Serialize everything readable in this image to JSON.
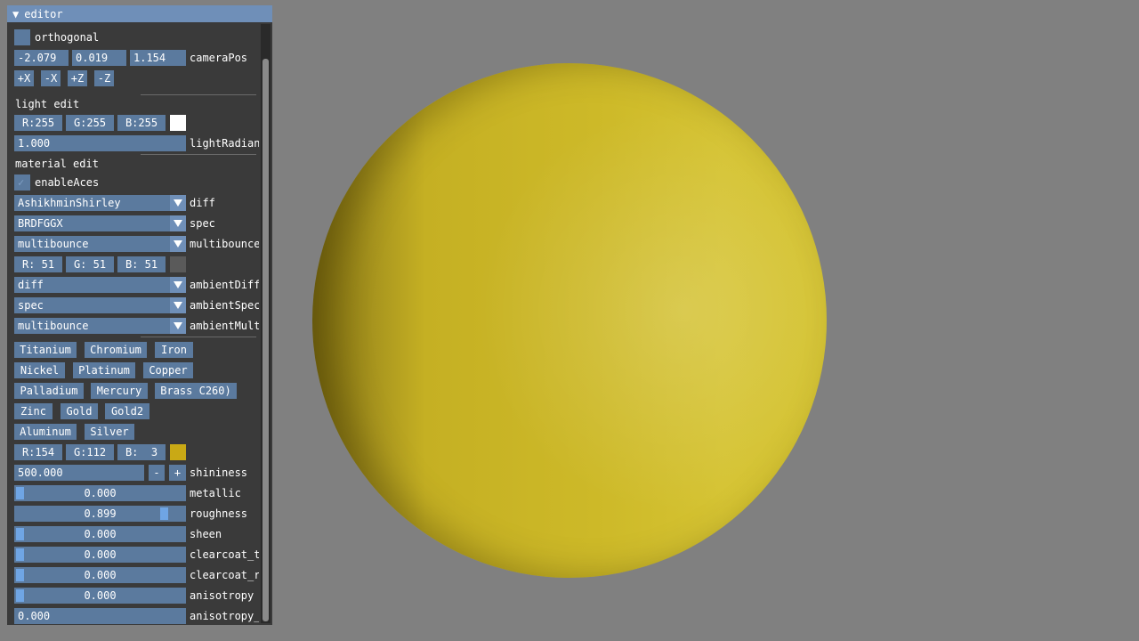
{
  "window": {
    "title": "editor",
    "collapse_glyph": "▼"
  },
  "camera": {
    "orthogonal_label": "orthogonal",
    "pos": [
      "-2.079",
      "0.019",
      "1.154"
    ],
    "pos_label": "cameraPos",
    "buttons": [
      "+X",
      "-X",
      "+Z",
      "-Z"
    ]
  },
  "light": {
    "header": "light edit",
    "rgb": [
      "R:255",
      "G:255",
      "B:255"
    ],
    "swatch_color": "#ffffff",
    "radiance": "1.000",
    "radiance_label": "lightRadian"
  },
  "material": {
    "header": "material edit",
    "enable_aces_label": "enableAces",
    "enable_aces_checked": true,
    "diff": {
      "value": "AshikhminShirley",
      "label": "diff"
    },
    "spec": {
      "value": "BRDFGGX",
      "label": "spec"
    },
    "multibounce": {
      "value": "multibounce",
      "label": "multibounce"
    },
    "ambient_rgb": [
      "R: 51",
      "G: 51",
      "B: 51"
    ],
    "ambient_swatch_color": "#333333",
    "ambient_diff": {
      "value": "diff",
      "label": "ambientDiff"
    },
    "ambient_spec": {
      "value": "spec",
      "label": "ambientSpec"
    },
    "ambient_mult": {
      "value": "multibounce",
      "label": "ambientMult"
    },
    "presets": [
      [
        "Titanium",
        "Chromium",
        "Iron"
      ],
      [
        "Nickel",
        "Platinum",
        "Copper"
      ],
      [
        "Palladium",
        "Mercury",
        "Brass C260)"
      ],
      [
        "Zinc",
        "Gold",
        "Gold2"
      ],
      [
        "Aluminum",
        "Silver"
      ]
    ],
    "base_rgb": [
      "R:154",
      "G:112",
      "B:  3"
    ],
    "base_swatch_color": "#c9a915",
    "shininess": {
      "value": "500.000",
      "label": "shininess",
      "minus": "-",
      "plus": "+"
    },
    "sliders": [
      {
        "value": "0.000",
        "label": "metallic",
        "fraction": 0.0
      },
      {
        "value": "0.899",
        "label": "roughness",
        "fraction": 0.899
      },
      {
        "value": "0.000",
        "label": "sheen",
        "fraction": 0.0
      },
      {
        "value": "0.000",
        "label": "clearcoat_t",
        "fraction": 0.0
      },
      {
        "value": "0.000",
        "label": "clearcoat_r",
        "fraction": 0.0
      },
      {
        "value": "0.000",
        "label": "anisotropy",
        "fraction": 0.0
      }
    ],
    "anisotropy_rot": {
      "value": "0.000",
      "label": "anisotropy_"
    }
  },
  "colors": {
    "accent": "#5b7a9e",
    "title": "#6f8fb8",
    "grab": "#6fa5e4",
    "background": "#808080",
    "sphere": "#cdb928"
  }
}
